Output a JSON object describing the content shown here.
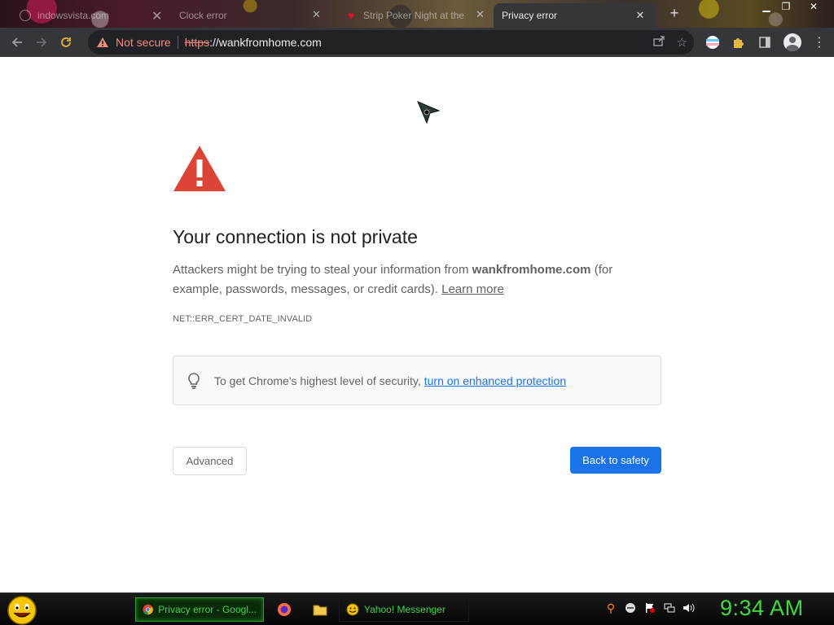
{
  "tabs": [
    {
      "title": "indowsvista.com",
      "state": "inactive",
      "favicon": "globe-icon"
    },
    {
      "title": "Clock error",
      "state": "inactive",
      "favicon": "globe-icon"
    },
    {
      "title": "Strip Poker Night at the",
      "state": "inactive",
      "favicon": "heart-icon"
    },
    {
      "title": "Privacy error",
      "state": "active",
      "favicon": "none"
    }
  ],
  "toolbar": {
    "security_label": "Not secure",
    "url_scheme": "https",
    "url_rest": "://wankfromhome.com"
  },
  "page": {
    "heading": "Your connection is not private",
    "explanation_prefix": "Attackers might be trying to steal your information from ",
    "explanation_host": "wankfromhome.com",
    "explanation_suffix": " (for example, passwords, messages, or credit cards). ",
    "learn_more": "Learn more",
    "error_code": "NET::ERR_CERT_DATE_INVALID",
    "enhanced_text": "To get Chrome's highest level of security,",
    "enhanced_link": "turn on enhanced protection",
    "advanced_button": "Advanced",
    "back_button": "Back to safety"
  },
  "taskbar": {
    "tasks": [
      {
        "label": "Privacy error - Googl...",
        "active": true
      },
      {
        "label": "Yahoo! Messenger",
        "active": false
      }
    ],
    "clock": "9:34 AM"
  },
  "colors": {
    "accent": "#1a73e8",
    "warning_red": "#db4437",
    "not_secure": "#f28b82",
    "taskbar_text": "#41d84a"
  }
}
